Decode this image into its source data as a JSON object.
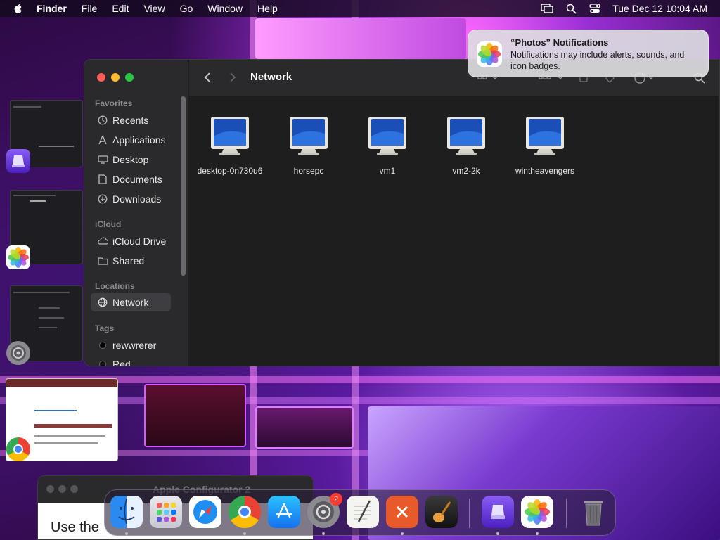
{
  "menubar": {
    "app_name": "Finder",
    "items": [
      "File",
      "Edit",
      "View",
      "Go",
      "Window",
      "Help"
    ],
    "clock": "Tue Dec 12  10:04 AM"
  },
  "notification": {
    "title": "“Photos” Notifications",
    "body": "Notifications may include alerts, sounds, and icon badges."
  },
  "finder": {
    "title": "Network",
    "sidebar": {
      "favorites_title": "Favorites",
      "favorites": [
        "Recents",
        "Applications",
        "Desktop",
        "Documents",
        "Downloads"
      ],
      "icloud_title": "iCloud",
      "icloud": [
        "iCloud Drive",
        "Shared"
      ],
      "locations_title": "Locations",
      "locations": [
        "Network"
      ],
      "tags_title": "Tags",
      "tags": [
        "rewwrerer",
        "Red"
      ]
    },
    "items": [
      "desktop-0n730u6",
      "horsepc",
      "vm1",
      "vm2-2k",
      "wintheavengers"
    ]
  },
  "background_window": {
    "title": "Apple Configurator 2",
    "body_text": "Use the"
  },
  "dock": {
    "settings_badge": "2"
  },
  "colors": {
    "close": "#ff5f57",
    "minimize": "#febc2e",
    "zoom": "#28c840",
    "selection": "#3e3e42"
  }
}
